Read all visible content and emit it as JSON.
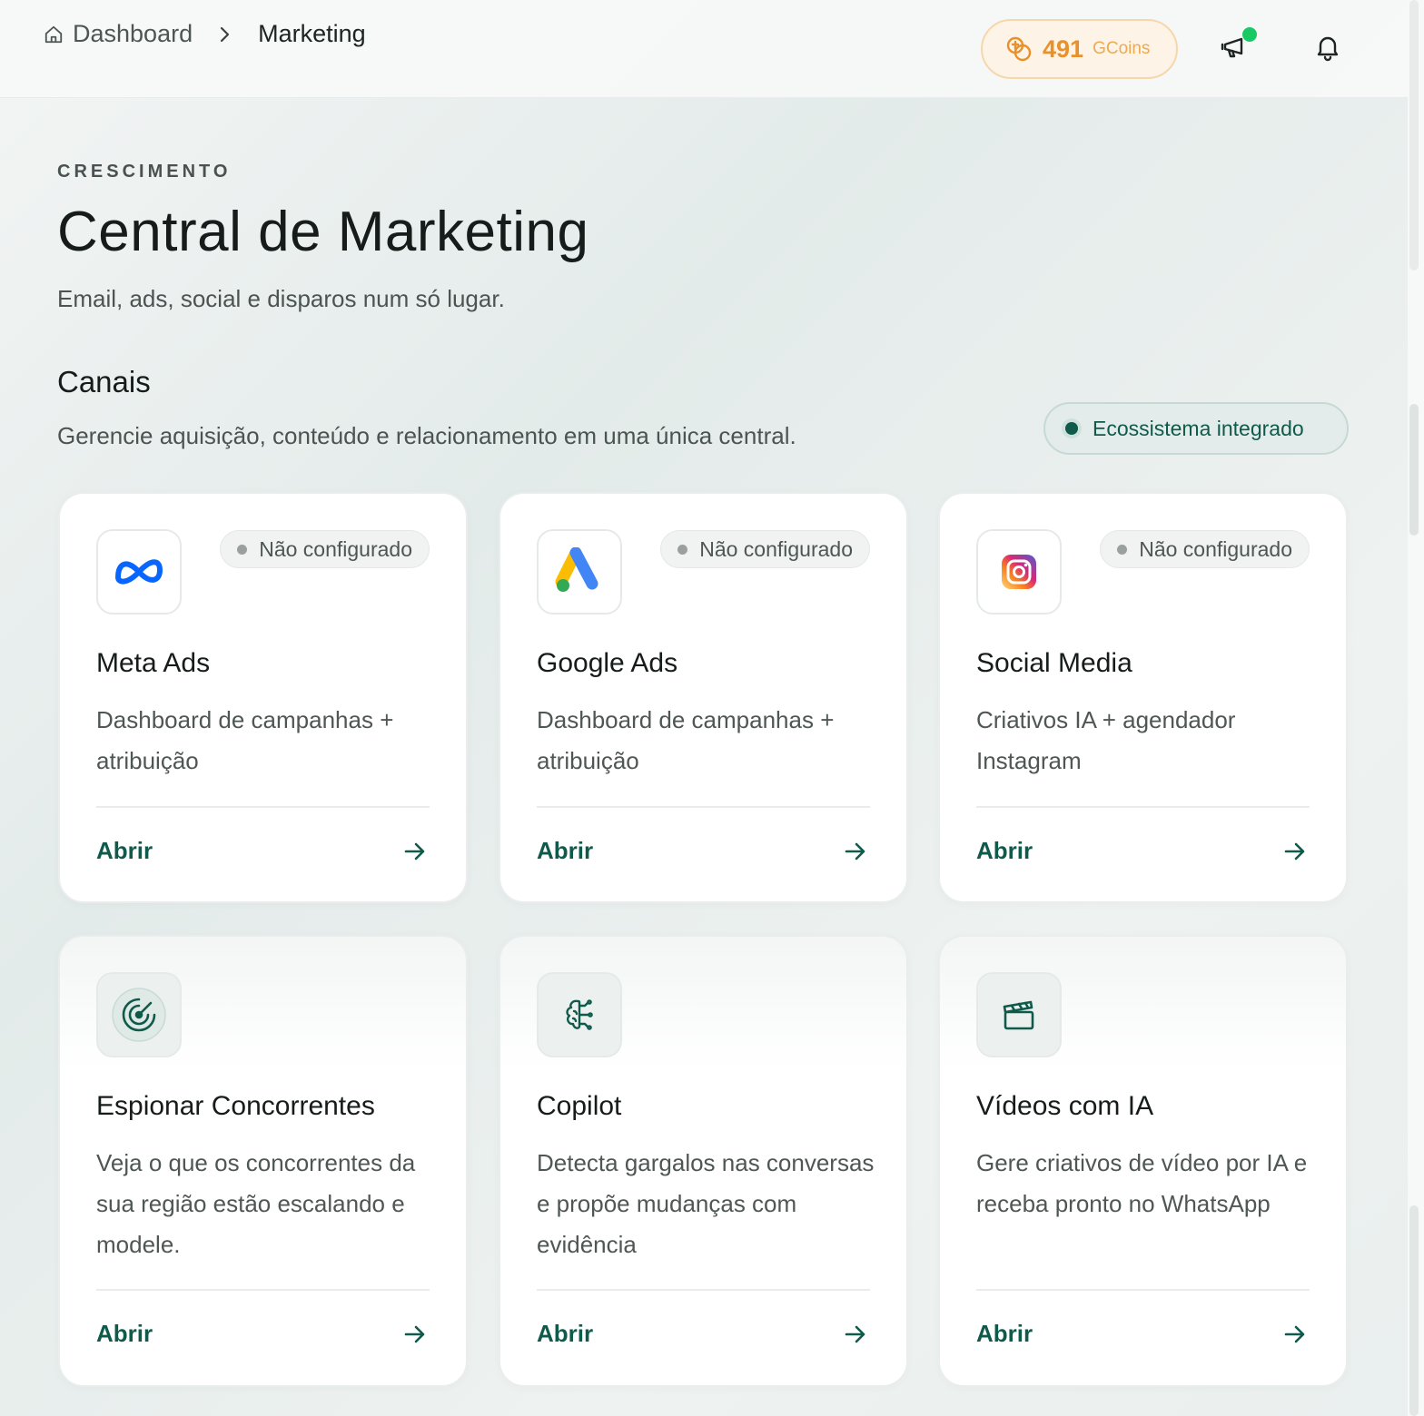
{
  "breadcrumb": {
    "home": "Dashboard",
    "current": "Marketing"
  },
  "coins": {
    "value": "491",
    "unit": "GCoins",
    "accent": "#e8912b"
  },
  "header": {
    "eyebrow": "CRESCIMENTO",
    "title": "Central de Marketing",
    "subtitle": "Email, ads, social e disparos num só lugar."
  },
  "section": {
    "title": "Canais",
    "subtitle": "Gerencie aquisição, conteúdo e relacionamento em uma única central.",
    "badge": "Ecossistema integrado"
  },
  "cards": [
    {
      "title": "Meta Ads",
      "desc": "Dashboard de campanhas + atribuição",
      "status": "Não configurado",
      "action": "Abrir",
      "icon": "meta-logo-icon"
    },
    {
      "title": "Google Ads",
      "desc": "Dashboard de campanhas + atribuição",
      "status": "Não configurado",
      "action": "Abrir",
      "icon": "google-ads-logo-icon"
    },
    {
      "title": "Social Media",
      "desc": "Criativos IA + agendador Instagram",
      "status": "Não configurado",
      "action": "Abrir",
      "icon": "instagram-logo-icon"
    },
    {
      "title": "Espionar Concorrentes",
      "desc": "Veja o que os concorrentes da sua região estão escalando e modele.",
      "action": "Abrir",
      "icon": "radar-icon"
    },
    {
      "title": "Copilot",
      "desc": "Detecta gargalos nas conversas e propõe mudanças com evidência",
      "action": "Abrir",
      "icon": "brain-icon"
    },
    {
      "title": "Vídeos com IA",
      "desc": "Gere criativos de vídeo por IA e receba pronto no WhatsApp",
      "action": "Abrir",
      "icon": "clapperboard-icon"
    }
  ],
  "colors": {
    "brand": "#0f5a4b",
    "status_online": "#17c964"
  }
}
